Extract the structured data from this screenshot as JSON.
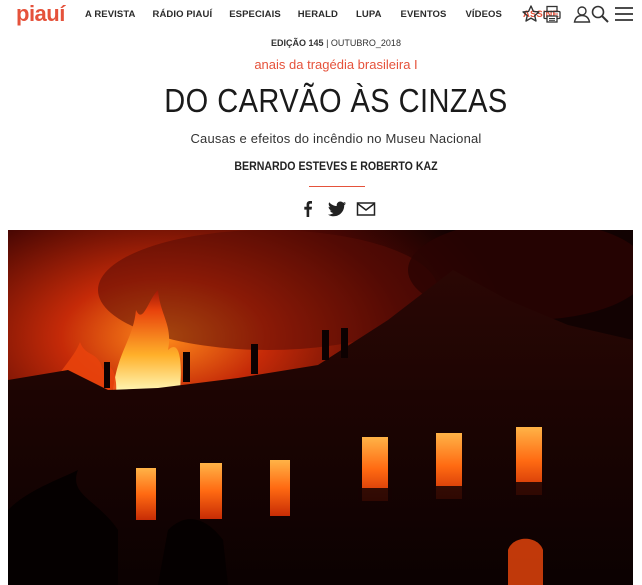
{
  "brand": {
    "logo": "piauí",
    "accent_color": "#e5523b"
  },
  "nav": {
    "items": [
      {
        "label": "A REVISTA"
      },
      {
        "label": "RÁDIO PIAUÍ"
      },
      {
        "label": "ESPECIAIS"
      },
      {
        "label": "HERALD"
      },
      {
        "label": "LUPA"
      },
      {
        "label": "EVENTOS"
      },
      {
        "label": "VÍDEOS"
      },
      {
        "label": "ASSINE",
        "accent": true
      }
    ],
    "icons": [
      "star-icon",
      "printer-icon",
      "user-icon",
      "search-icon",
      "menu-icon"
    ]
  },
  "article": {
    "edition_label": "EDIÇÃO 145",
    "edition_date": " | OUTUBRO_2018",
    "kicker": "anais da tragédia brasileira I",
    "title": "DO CARVÃO ÀS CINZAS",
    "subtitle": "Causas e efeitos do incêndio no Museu Nacional",
    "byline": "BERNARDO ESTEVES E ROBERTO KAZ",
    "share_icons": [
      "facebook-icon",
      "twitter-icon",
      "email-icon"
    ]
  },
  "hero_image": {
    "subject": "museum-building-on-fire"
  }
}
